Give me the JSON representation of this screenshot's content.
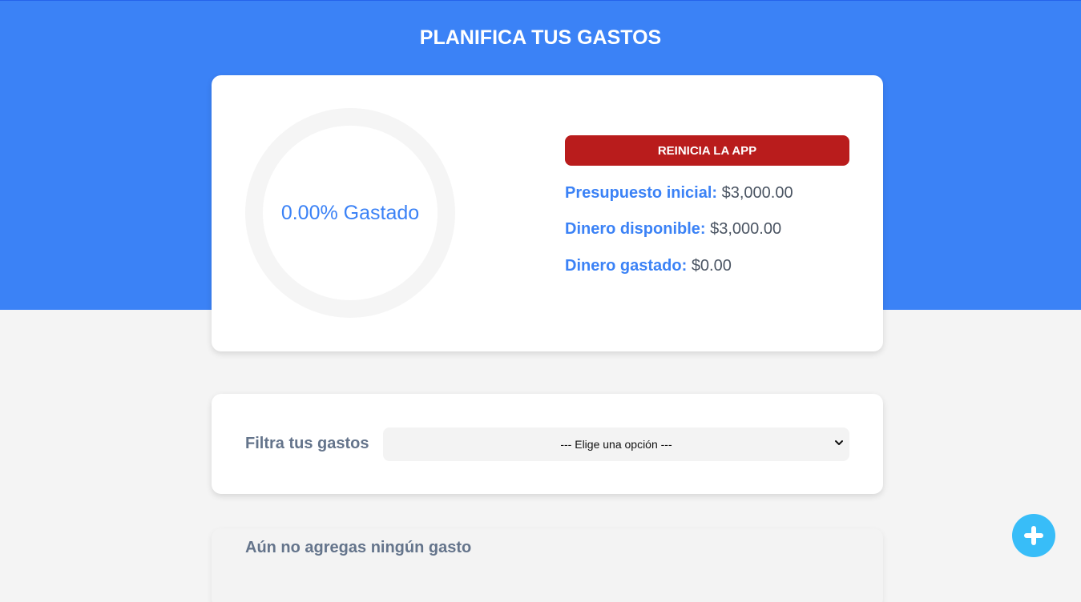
{
  "header": {
    "title": "PLANIFICA TUS GASTOS",
    "bg_color": "#3b82f6"
  },
  "budget": {
    "progress_percent": 0,
    "progress_text": "0.00% Gastado",
    "reset_label": "REINICIA LA APP",
    "reset_color": "#b91c1c",
    "initial_label": "Presupuesto inicial:",
    "initial_value": "$3,000.00",
    "available_label": "Dinero disponible:",
    "available_value": "$3,000.00",
    "spent_label": "Dinero gastado:",
    "spent_value": "$0.00"
  },
  "filter": {
    "label": "Filtra tus gastos",
    "selected": "--- Elige una opción ---"
  },
  "expenses": {
    "empty_text": "Aún no agregas ningún gasto"
  },
  "fab": {
    "icon": "plus-icon",
    "color": "#38bdf8"
  }
}
